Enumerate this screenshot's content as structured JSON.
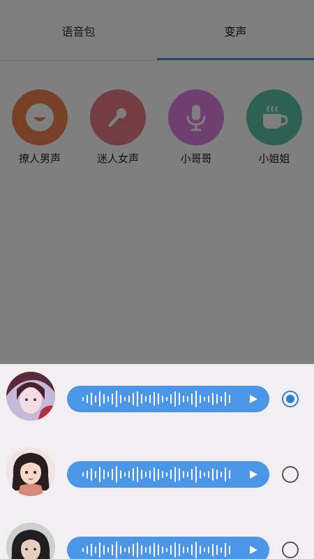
{
  "tabs": [
    {
      "label": "语音包",
      "selected": false
    },
    {
      "label": "变声",
      "selected": true
    }
  ],
  "categories": [
    {
      "label": "撩人男声",
      "icon": "smile-icon",
      "color": "#f0814e"
    },
    {
      "label": "迷人女声",
      "icon": "microphone-handheld-icon",
      "color": "#e77b83"
    },
    {
      "label": "小哥哥",
      "icon": "microphone-icon",
      "color": "#dd7ee0"
    },
    {
      "label": "小姐姐",
      "icon": "teacup-icon",
      "color": "#5bc3a4"
    }
  ],
  "voice_samples": [
    {
      "avatar": "anime-girl-avatar",
      "selected": true
    },
    {
      "avatar": "cartoon-girl-avatar",
      "selected": false
    },
    {
      "avatar": "photo-girl-avatar",
      "selected": false
    }
  ],
  "colors": {
    "accent": "#3f8fe0",
    "bubble": "#4b96e6",
    "sheet_bg": "#f1eff2"
  }
}
